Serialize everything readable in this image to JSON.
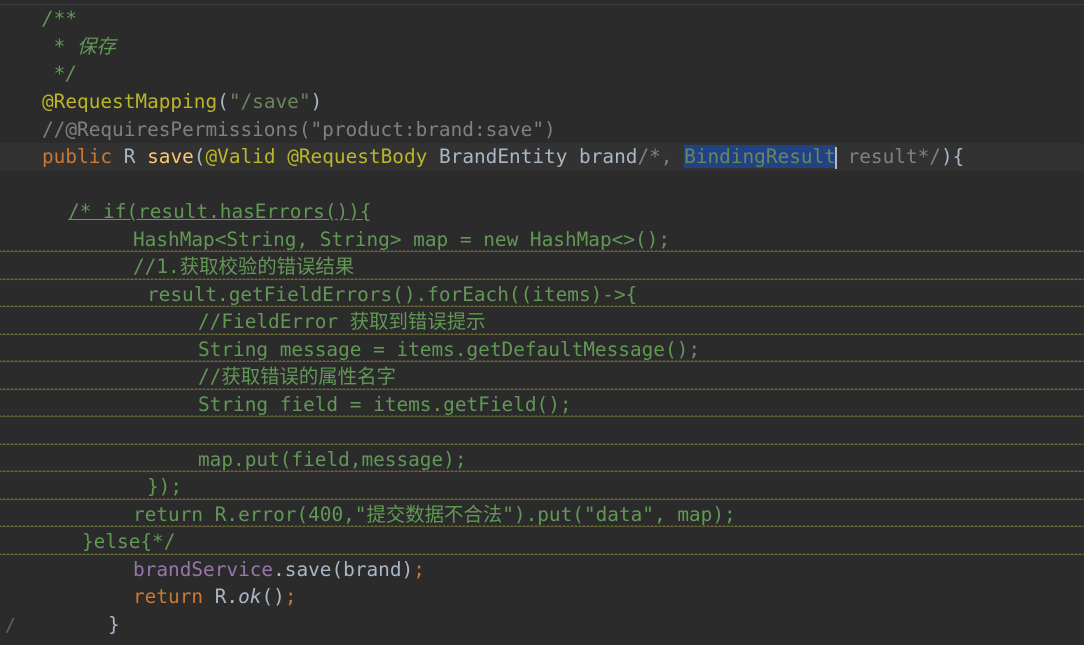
{
  "editor": {
    "lines": [
      {
        "id": "l1",
        "text": "/**"
      },
      {
        "id": "l2",
        "text": " * 保存"
      },
      {
        "id": "l3",
        "text": " */"
      },
      {
        "id": "l4a",
        "text": "@RequestMapping"
      },
      {
        "id": "l4b",
        "text": "("
      },
      {
        "id": "l4c",
        "text": "\"/save\""
      },
      {
        "id": "l4d",
        "text": ")"
      },
      {
        "id": "l5",
        "text": "//@RequiresPermissions(\"product:brand:save\")"
      },
      {
        "id": "l6a",
        "text": "public "
      },
      {
        "id": "l6b",
        "text": "R "
      },
      {
        "id": "l6c",
        "text": "save"
      },
      {
        "id": "l6d",
        "text": "("
      },
      {
        "id": "l6e",
        "text": "@Valid @RequestBody "
      },
      {
        "id": "l6f",
        "text": "BrandEntity brand"
      },
      {
        "id": "l6g",
        "text": "/*, "
      },
      {
        "id": "l6h",
        "text": "BindingResult"
      },
      {
        "id": "l6i",
        "text": " result*/"
      },
      {
        "id": "l6j",
        "text": "){"
      },
      {
        "id": "l8",
        "text": "/* if(result.hasErrors()){"
      },
      {
        "id": "l9",
        "text": "HashMap<String, String> map = new HashMap<>();"
      },
      {
        "id": "l10",
        "text": "//1.获取校验的错误结果"
      },
      {
        "id": "l11",
        "text": "result.getFieldErrors().forEach((items)->{"
      },
      {
        "id": "l12",
        "text": "//FieldError 获取到错误提示"
      },
      {
        "id": "l13",
        "text": "String message = items.getDefaultMessage();"
      },
      {
        "id": "l14",
        "text": "//获取错误的属性名字"
      },
      {
        "id": "l15",
        "text": "String field = items.getField();"
      },
      {
        "id": "l17",
        "text": "map.put(field,message);"
      },
      {
        "id": "l18",
        "text": "});"
      },
      {
        "id": "l19",
        "text": "return R.error(400,\"提交数据不合法\").put(\"data\", map);"
      },
      {
        "id": "l20",
        "text": "}else{*/"
      },
      {
        "id": "l21a",
        "text": "brandService"
      },
      {
        "id": "l21b",
        "text": ".save(brand)"
      },
      {
        "id": "l21c",
        "text": ";"
      },
      {
        "id": "l22a",
        "text": "return "
      },
      {
        "id": "l22b",
        "text": "R."
      },
      {
        "id": "l22c",
        "text": "ok"
      },
      {
        "id": "l22d",
        "text": "()"
      },
      {
        "id": "l22e",
        "text": ";"
      },
      {
        "id": "l23",
        "text": "}"
      }
    ],
    "gutter_mark": "/",
    "colors": {
      "background": "#2b2b2b",
      "doc_comment": "#629755",
      "line_comment": "#808080",
      "annotation": "#bbb529",
      "string": "#6a8759",
      "keyword": "#cc7832",
      "method": "#ffc66d",
      "plain": "#a9b7c6",
      "field": "#9876aa",
      "selection": "#214283",
      "caret_row": "#323232"
    }
  }
}
